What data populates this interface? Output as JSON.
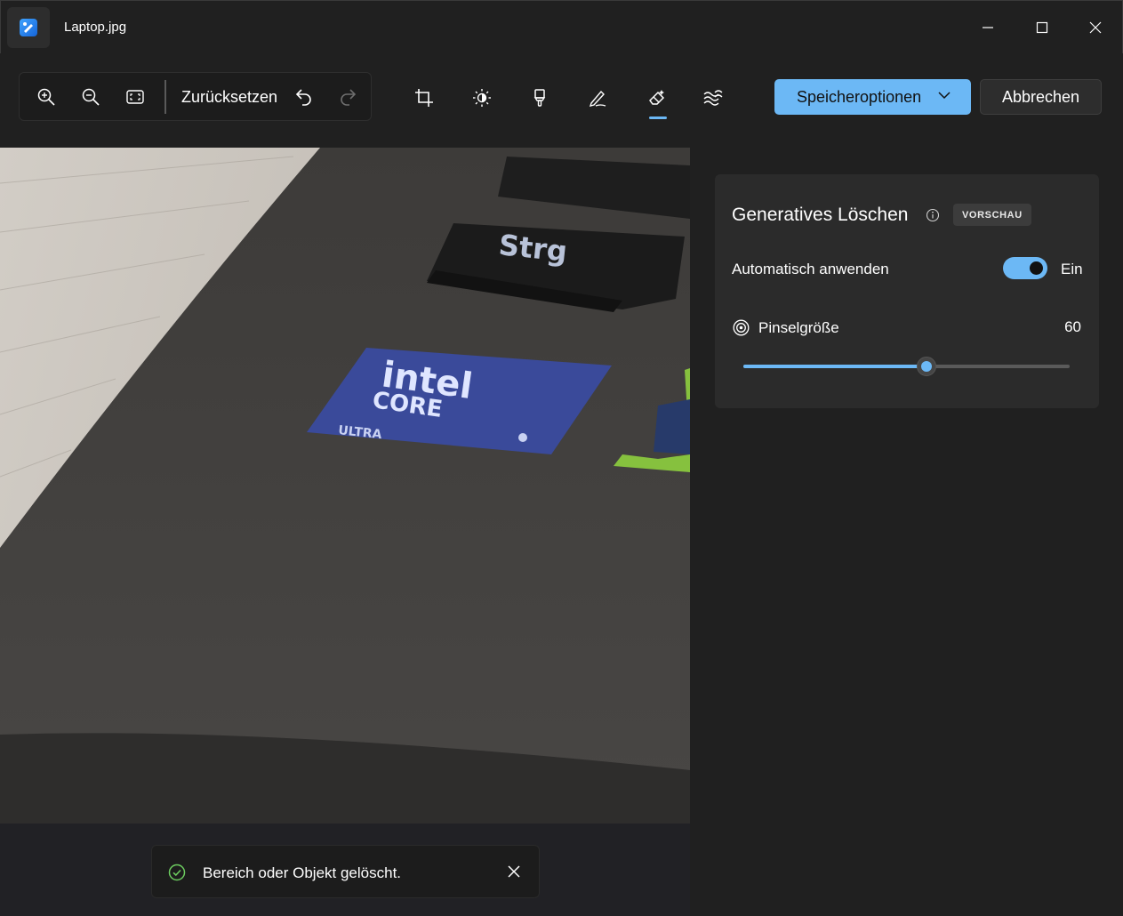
{
  "window": {
    "title": "Laptop.jpg",
    "controls": [
      "minimize-icon",
      "maximize-icon",
      "close-icon"
    ]
  },
  "toolbar": {
    "zoom_in_icon": "zoom-in-icon",
    "zoom_out_icon": "zoom-out-icon",
    "fit_icon": "fit-to-window-icon",
    "reset_label": "Zurücksetzen",
    "undo_icon": "undo-icon",
    "redo_icon": "redo-icon",
    "tools": [
      "crop-icon",
      "adjust-brightness-icon",
      "filter-icon",
      "markup-pen-icon",
      "erase-icon",
      "background-blur-icon"
    ],
    "active_tool": "erase-icon",
    "save_label": "Speicheroptionen",
    "cancel_label": "Abbrechen"
  },
  "image": {
    "key_label": "Strg",
    "sticker_line1": "intel",
    "sticker_line2": "CORE",
    "sticker_line3": "ULTRA"
  },
  "panel": {
    "title": "Generatives Löschen",
    "badge": "VORSCHAU",
    "auto_apply_label": "Automatisch anwenden",
    "auto_apply_state": "Ein",
    "auto_apply_on": true,
    "brush_size_label": "Pinselgröße",
    "brush_size_value": "60",
    "brush_size_fraction": 0.56
  },
  "toast": {
    "message": "Bereich oder Objekt gelöscht."
  },
  "colors": {
    "accent": "#6cb8f5",
    "background": "#202020",
    "card": "#2b2b2b",
    "success": "#6ccb5f"
  }
}
